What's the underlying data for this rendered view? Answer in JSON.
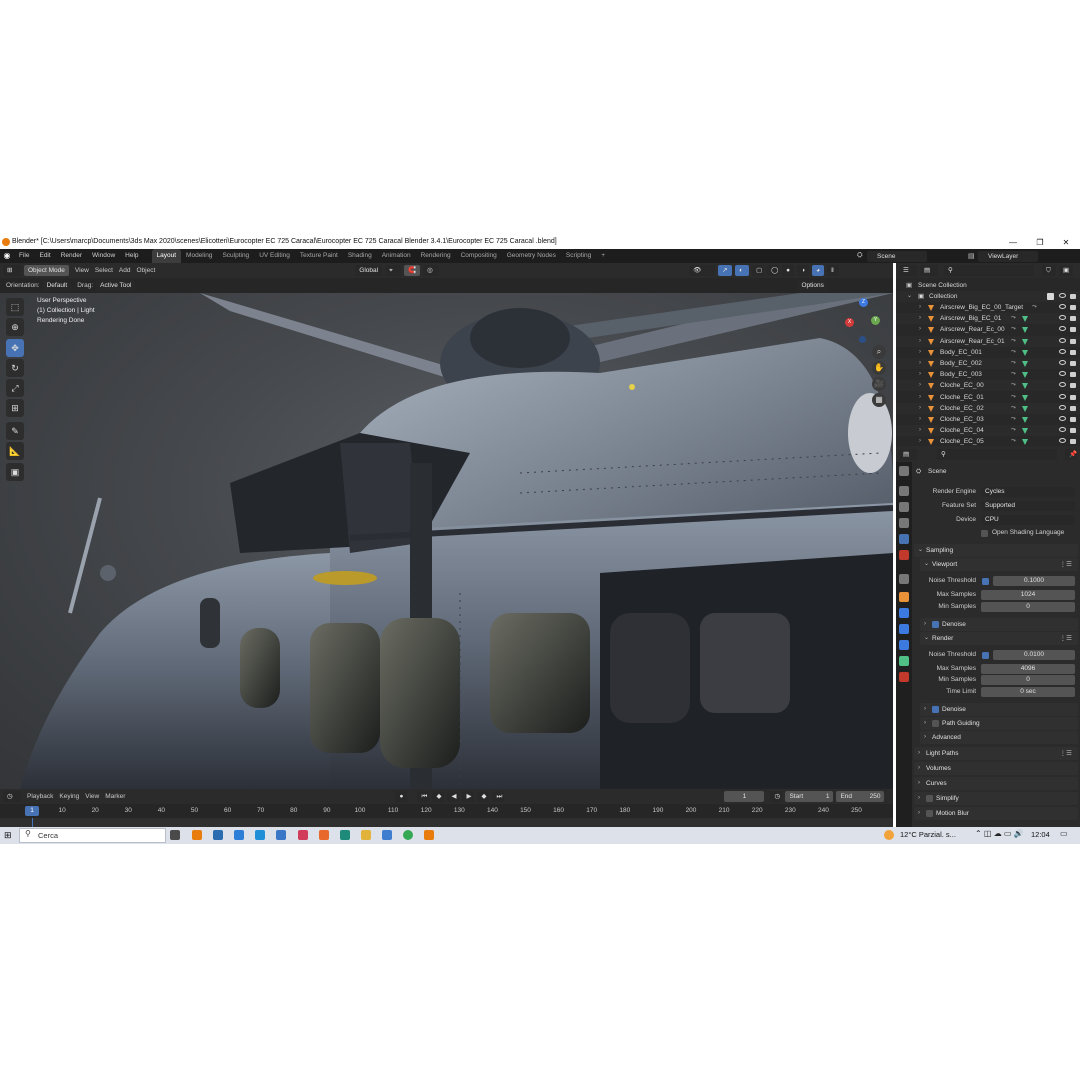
{
  "window": {
    "title": "Blender* [C:\\Users\\marcp\\Documents\\3ds Max 2020\\scenes\\Elicotteri\\Eurocopter EC 725 Caracal\\Eurocopter EC 725 Caracal Blender 3.4.1\\Eurocopter EC 725 Caracal .blend]",
    "minimize": "—",
    "maximize": "❐",
    "close": "✕"
  },
  "menu": [
    "File",
    "Edit",
    "Render",
    "Window",
    "Help"
  ],
  "workspaces": [
    "Layout",
    "Modeling",
    "Sculpting",
    "UV Editing",
    "Texture Paint",
    "Shading",
    "Animation",
    "Rendering",
    "Compositing",
    "Geometry Nodes",
    "Scripting",
    "+"
  ],
  "scene_name": "Scene",
  "view_layer": "ViewLayer",
  "viewport_header": {
    "mode": "Object Mode",
    "menus": [
      "View",
      "Select",
      "Add",
      "Object"
    ],
    "transform": "Global",
    "orientation_label": "Orientation:",
    "orientation_value": "Default",
    "drag_label": "Drag:",
    "drag_value": "Active Tool",
    "options": "Options"
  },
  "viewport_overlay": {
    "line1": "User Perspective",
    "line2": "(1) Collection | Light",
    "line3": "Rendering Done"
  },
  "gizmo": {
    "x": "X",
    "y": "Y",
    "z": "Z"
  },
  "timeline": {
    "menus": [
      "Playback",
      "Keying",
      "View",
      "Marker"
    ],
    "current_frame": "1",
    "start_label": "Start",
    "start": "1",
    "end_label": "End",
    "end": "250",
    "ruler": [
      "1",
      "10",
      "20",
      "30",
      "40",
      "50",
      "60",
      "70",
      "80",
      "90",
      "100",
      "110",
      "120",
      "130",
      "140",
      "150",
      "160",
      "170",
      "180",
      "190",
      "200",
      "210",
      "220",
      "230",
      "240",
      "250"
    ]
  },
  "outliner": {
    "scene_collection": "Scene Collection",
    "collection": "Collection",
    "items": [
      "Airscrew_Big_EC_00_Target",
      "Airscrew_Big_EC_01",
      "Airscrew_Rear_Ec_00",
      "Airscrew_Rear_Ec_01",
      "Body_EC_001",
      "Body_EC_002",
      "Body_EC_003",
      "Cloche_EC_00",
      "Cloche_EC_01",
      "Cloche_EC_02",
      "Cloche_EC_03",
      "Cloche_EC_04",
      "Cloche_EC_05"
    ]
  },
  "properties": {
    "context": "Scene",
    "render_engine_label": "Render Engine",
    "render_engine": "Cycles",
    "feature_set_label": "Feature Set",
    "feature_set": "Supported",
    "device_label": "Device",
    "device": "CPU",
    "osl_label": "Open Shading Language",
    "sampling": "Sampling",
    "viewport": "Viewport",
    "noise_threshold_label": "Noise Threshold",
    "vp_noise_threshold": "0.1000",
    "max_samples_label": "Max Samples",
    "vp_max_samples": "1024",
    "min_samples_label": "Min Samples",
    "vp_min_samples": "0",
    "denoise": "Denoise",
    "render": "Render",
    "r_noise_threshold": "0.0100",
    "r_max_samples": "4096",
    "r_min_samples": "0",
    "time_limit_label": "Time Limit",
    "time_limit": "0 sec",
    "path_guiding": "Path Guiding",
    "advanced": "Advanced",
    "light_paths": "Light Paths",
    "volumes": "Volumes",
    "curves": "Curves",
    "simplify": "Simplify",
    "motion_blur": "Motion Blur"
  },
  "taskbar": {
    "search": "Cerca",
    "weather": "12°C  Parzial. s...",
    "time": "12:04"
  },
  "colors": {
    "accent": "#4772b3",
    "object_orange": "#e9923a",
    "mesh_green": "#4fbf86",
    "panel_bg": "#2b2b2b"
  }
}
